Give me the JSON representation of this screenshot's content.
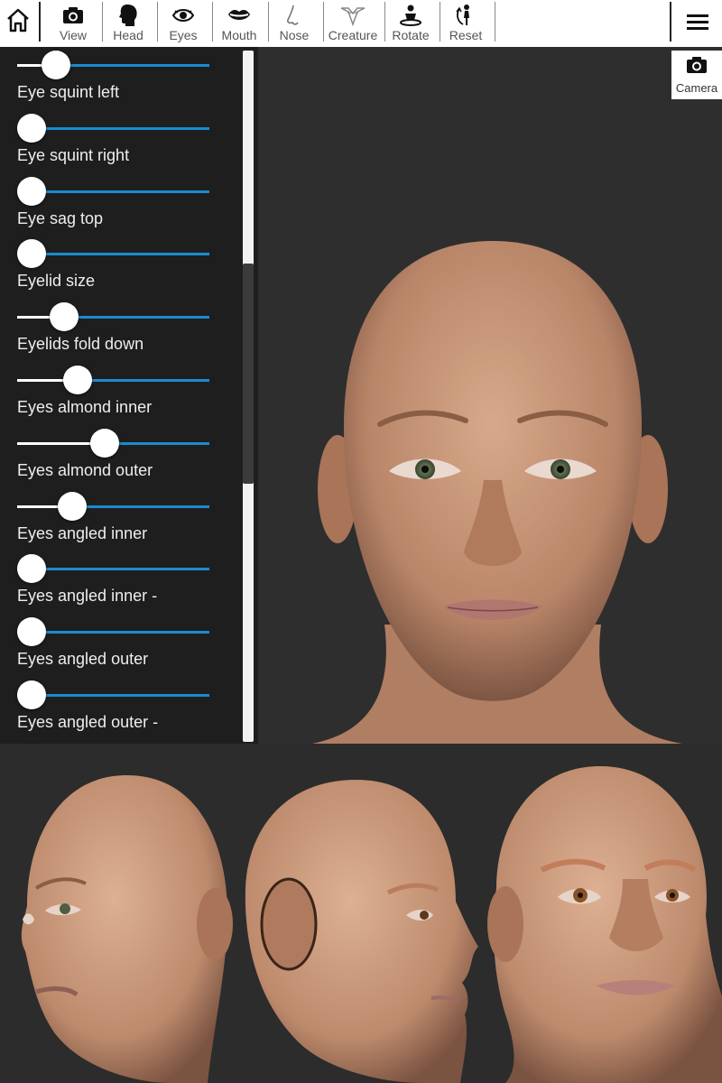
{
  "toolbar": {
    "home_label": "",
    "items": [
      {
        "label": "View",
        "icon": "camera-icon"
      },
      {
        "label": "Head",
        "icon": "head-silhouette-icon"
      },
      {
        "label": "Eyes",
        "icon": "eye-icon"
      },
      {
        "label": "Mouth",
        "icon": "lips-icon"
      },
      {
        "label": "Nose",
        "icon": "nose-icon"
      },
      {
        "label": "Creature",
        "icon": "creature-icon"
      },
      {
        "label": "Rotate",
        "icon": "rotate-person-icon"
      },
      {
        "label": "Reset",
        "icon": "reset-person-icon"
      }
    ],
    "menu_icon": "hamburger-menu-icon"
  },
  "camera_button": {
    "label": "Camera",
    "icon": "camera-icon"
  },
  "sliders": [
    {
      "label": "Eye squint left",
      "value": 0.15
    },
    {
      "label": "Eye squint right",
      "value": 0.0
    },
    {
      "label": "Eye sag top",
      "value": 0.0
    },
    {
      "label": "Eyelid size",
      "value": 0.0
    },
    {
      "label": "Eyelids fold down",
      "value": 0.2
    },
    {
      "label": "Eyes almond inner",
      "value": 0.28
    },
    {
      "label": "Eyes almond outer",
      "value": 0.45
    },
    {
      "label": "Eyes angled inner",
      "value": 0.25
    },
    {
      "label": "Eyes angled inner -",
      "value": 0.0
    },
    {
      "label": "Eyes angled outer",
      "value": 0.0
    },
    {
      "label": "Eyes angled outer -",
      "value": 0.0
    }
  ],
  "colors": {
    "accent": "#1a8bd1",
    "panel": "#1e1e1e",
    "background": "#2d2d2d",
    "skin": "#c9987a"
  }
}
